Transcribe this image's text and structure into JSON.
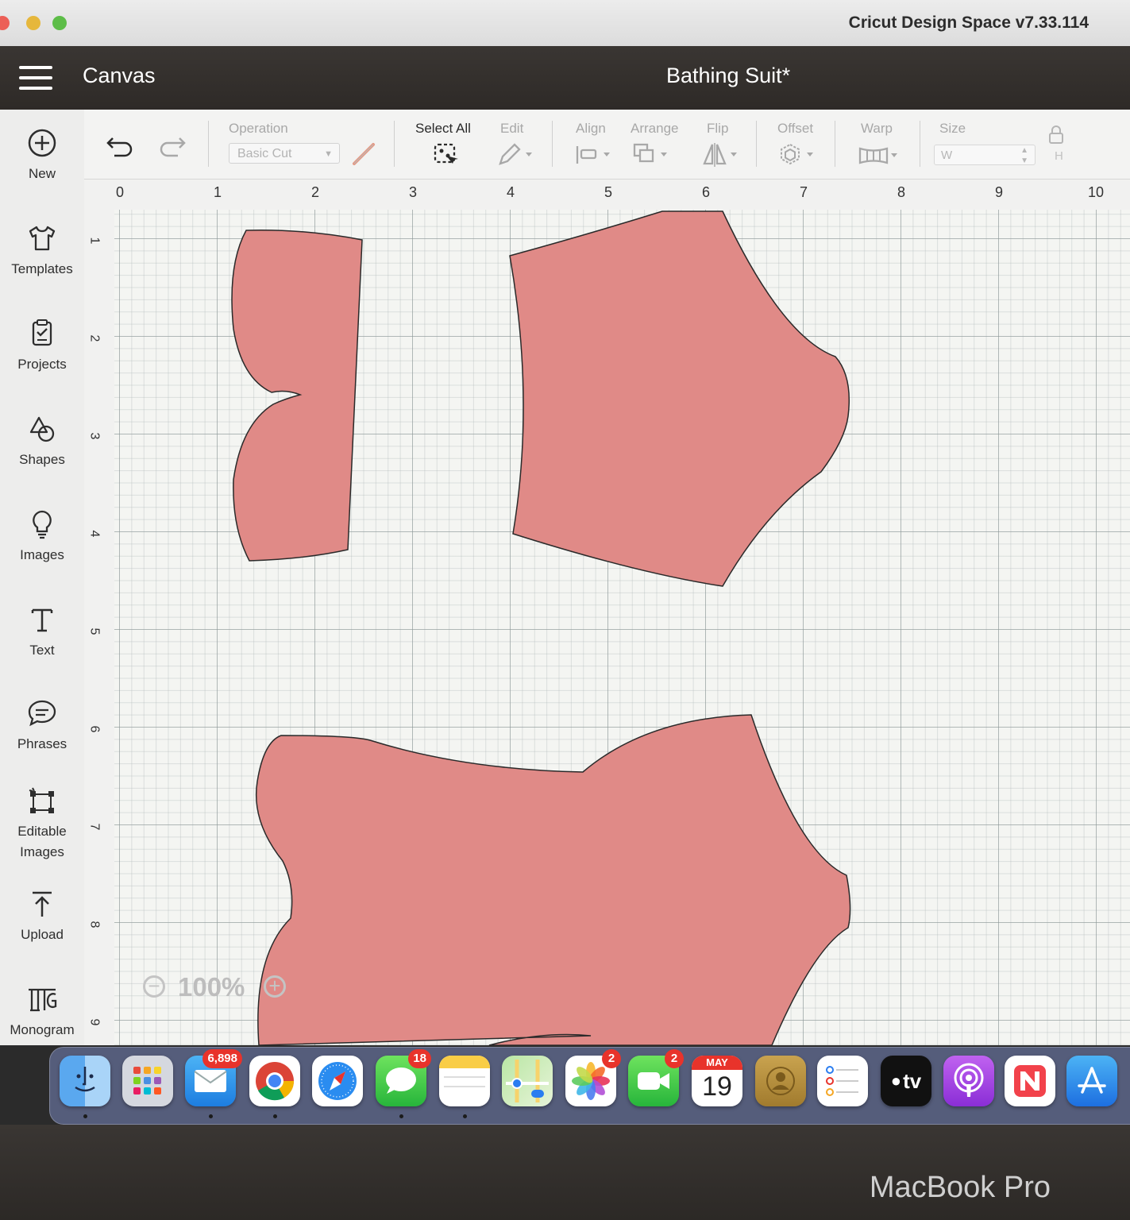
{
  "window": {
    "app_title": "Cricut Design Space  v7.33.114"
  },
  "header": {
    "section": "Canvas",
    "project_name": "Bathing Suit*"
  },
  "sidebar": {
    "items": [
      {
        "label": "New",
        "icon": "plus-circle-icon"
      },
      {
        "label": "Templates",
        "icon": "tshirt-icon"
      },
      {
        "label": "Projects",
        "icon": "projects-icon"
      },
      {
        "label": "Shapes",
        "icon": "shapes-icon"
      },
      {
        "label": "Images",
        "icon": "lightbulb-icon"
      },
      {
        "label": "Text",
        "icon": "text-icon"
      },
      {
        "label": "Phrases",
        "icon": "speech-bubble-icon"
      },
      {
        "label": "Editable",
        "label2": "Images",
        "icon": "editable-images-icon"
      },
      {
        "label": "Upload",
        "icon": "upload-icon"
      },
      {
        "label": "Monogram",
        "icon": "monogram-icon"
      }
    ]
  },
  "toolbar": {
    "operation_label": "Operation",
    "operation_value": "Basic Cut",
    "select_all": "Select All",
    "edit": "Edit",
    "align": "Align",
    "arrange": "Arrange",
    "flip": "Flip",
    "offset": "Offset",
    "warp": "Warp",
    "size": "Size",
    "size_w": "W",
    "size_h": "H"
  },
  "ruler": {
    "top": [
      "0",
      "1",
      "2",
      "3",
      "4",
      "5",
      "6",
      "7",
      "8",
      "9",
      "10"
    ],
    "left": [
      "1",
      "2",
      "3",
      "4",
      "5",
      "6",
      "7",
      "8",
      "9"
    ]
  },
  "zoom": {
    "value": "100%"
  },
  "shapes": {
    "fill": "#e08a87",
    "stroke": "#2a2a2a"
  },
  "dock": {
    "items": [
      {
        "name": "Finder",
        "icon": "finder-icon"
      },
      {
        "name": "Launchpad",
        "icon": "launchpad-icon"
      },
      {
        "name": "Mail",
        "icon": "mail-icon",
        "badge": "6,898"
      },
      {
        "name": "Chrome",
        "icon": "chrome-icon"
      },
      {
        "name": "Safari",
        "icon": "safari-icon"
      },
      {
        "name": "Messages",
        "icon": "messages-icon",
        "badge": "18"
      },
      {
        "name": "Notes",
        "icon": "notes-icon"
      },
      {
        "name": "Maps",
        "icon": "maps-icon"
      },
      {
        "name": "Photos",
        "icon": "photos-icon",
        "badge": "2"
      },
      {
        "name": "FaceTime",
        "icon": "facetime-icon",
        "badge": "2"
      },
      {
        "name": "Calendar",
        "icon": "calendar-icon",
        "month": "MAY",
        "day": "19"
      },
      {
        "name": "Contacts",
        "icon": "contacts-icon"
      },
      {
        "name": "Reminders",
        "icon": "reminders-icon"
      },
      {
        "name": "TV",
        "icon": "apple-tv-icon",
        "label": "tv"
      },
      {
        "name": "Podcasts",
        "icon": "podcasts-icon"
      },
      {
        "name": "News",
        "icon": "news-icon"
      },
      {
        "name": "App Store",
        "icon": "app-store-icon"
      }
    ]
  },
  "device_label": "MacBook Pro"
}
